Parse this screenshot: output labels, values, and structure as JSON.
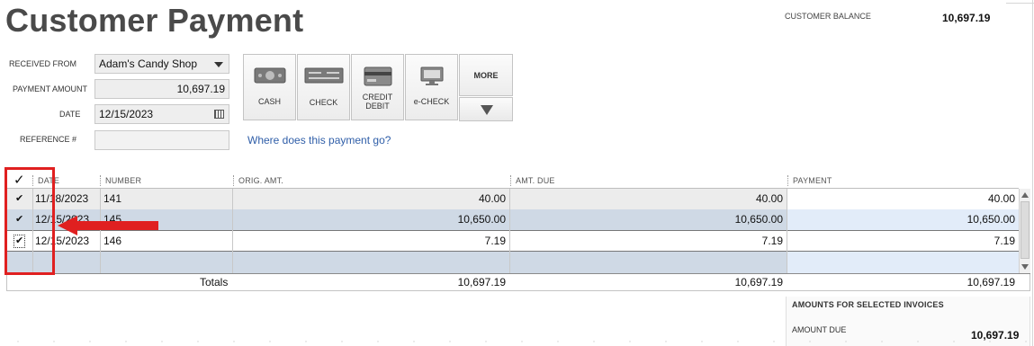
{
  "page": {
    "title": "Customer Payment"
  },
  "balance": {
    "label": "CUSTOMER BALANCE",
    "value": "10,697.19"
  },
  "form": {
    "received_from": {
      "label": "RECEIVED FROM",
      "value": "Adam's Candy Shop"
    },
    "payment_amount": {
      "label": "PAYMENT AMOUNT",
      "value": "10,697.19"
    },
    "date": {
      "label": "DATE",
      "value": "12/15/2023"
    },
    "reference": {
      "label": "REFERENCE #",
      "value": ""
    }
  },
  "payment_methods": [
    {
      "label": "CASH",
      "icon": "cash-icon"
    },
    {
      "label": "CHECK",
      "icon": "check-icon"
    },
    {
      "label": "CREDIT\nDEBIT",
      "icon": "credit-card-icon"
    },
    {
      "label": "e-CHECK",
      "icon": "echeck-icon"
    }
  ],
  "more_label": "MORE",
  "help_link": "Where does this payment go?",
  "table": {
    "headers": {
      "check": "✓",
      "date": "DATE",
      "number": "NUMBER",
      "orig_amt": "ORIG. AMT.",
      "amt_due": "AMT. DUE",
      "payment": "PAYMENT"
    },
    "rows": [
      {
        "checked": "✔",
        "date": "11/18/2023",
        "number": "141",
        "orig_amt": "40.00",
        "amt_due": "40.00",
        "payment": "40.00"
      },
      {
        "checked": "✔",
        "date": "12/15/2023",
        "number": "145",
        "orig_amt": "10,650.00",
        "amt_due": "10,650.00",
        "payment": "10,650.00"
      },
      {
        "checked": "✔",
        "date": "12/15/2023",
        "number": "146",
        "orig_amt": "7.19",
        "amt_due": "7.19",
        "payment": "7.19"
      }
    ],
    "totals": {
      "label": "Totals",
      "orig_amt": "10,697.19",
      "amt_due": "10,697.19",
      "payment": "10,697.19"
    }
  },
  "selected_invoices": {
    "heading": "AMOUNTS FOR SELECTED INVOICES",
    "amount_due_label": "AMOUNT DUE",
    "amount_due_value": "10,697.19"
  },
  "colors": {
    "annotation": "#e02020",
    "link": "#2f5ea8",
    "selected_row": "#cfd9e5"
  }
}
